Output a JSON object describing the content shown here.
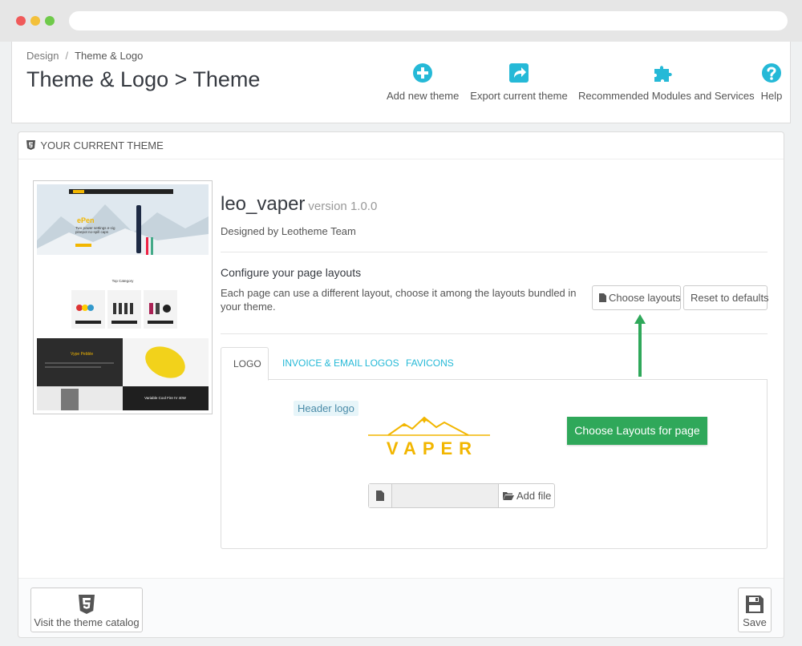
{
  "breadcrumb": {
    "parent": "Design",
    "separator": "/",
    "current": "Theme & Logo"
  },
  "page_title": "Theme & Logo > Theme",
  "toolbar": {
    "add_theme": "Add new theme",
    "export_theme": "Export current theme",
    "modules": "Recommended Modules and Services",
    "help": "Help"
  },
  "panel": {
    "heading": "YOUR CURRENT THEME",
    "theme_name": "leo_vaper",
    "theme_version": "version 1.0.0",
    "designed_by": "Designed by Leotheme Team",
    "config_title": "Configure your page layouts",
    "config_desc": "Each page can use a different layout, choose it among the layouts bundled in your theme.",
    "choose_layouts": "Choose layouts",
    "reset_defaults": "Reset to defaults"
  },
  "tabs": [
    {
      "label": "LOGO",
      "active": true
    },
    {
      "label": "INVOICE & EMAIL LOGOS",
      "active": false
    },
    {
      "label": "FAVICONS",
      "active": false
    }
  ],
  "logo_tab": {
    "header_logo_label": "Header logo",
    "logo_text": "VAPER",
    "file_value": "",
    "add_file": "Add file"
  },
  "footer": {
    "catalog_label": "Visit the theme catalog",
    "save_label": "Save"
  },
  "annotation": {
    "callout": "Choose Layouts for page"
  },
  "preview": {
    "hero_title": "ePen",
    "hero_line1": "Two power settings e-cig",
    "hero_line2": "pinepot no-spill caps",
    "category_title": "Top Category",
    "promo_title": "Vype Pebble",
    "promo2_title": "Variable Cool Fire IV 40W"
  },
  "colors": {
    "accent": "#25b9d7",
    "callout": "#2fa85a",
    "logo": "#f2b600",
    "title": "#363a41"
  },
  "icons": {
    "add_theme": "plus-circle-icon",
    "export_theme": "share-icon",
    "modules": "puzzle-icon",
    "help": "question-circle-icon",
    "heading": "html5-icon",
    "choose": "file-icon",
    "upload_file": "file-icon",
    "add_file": "folder-open-icon",
    "catalog": "html5-icon",
    "save": "save-icon"
  }
}
